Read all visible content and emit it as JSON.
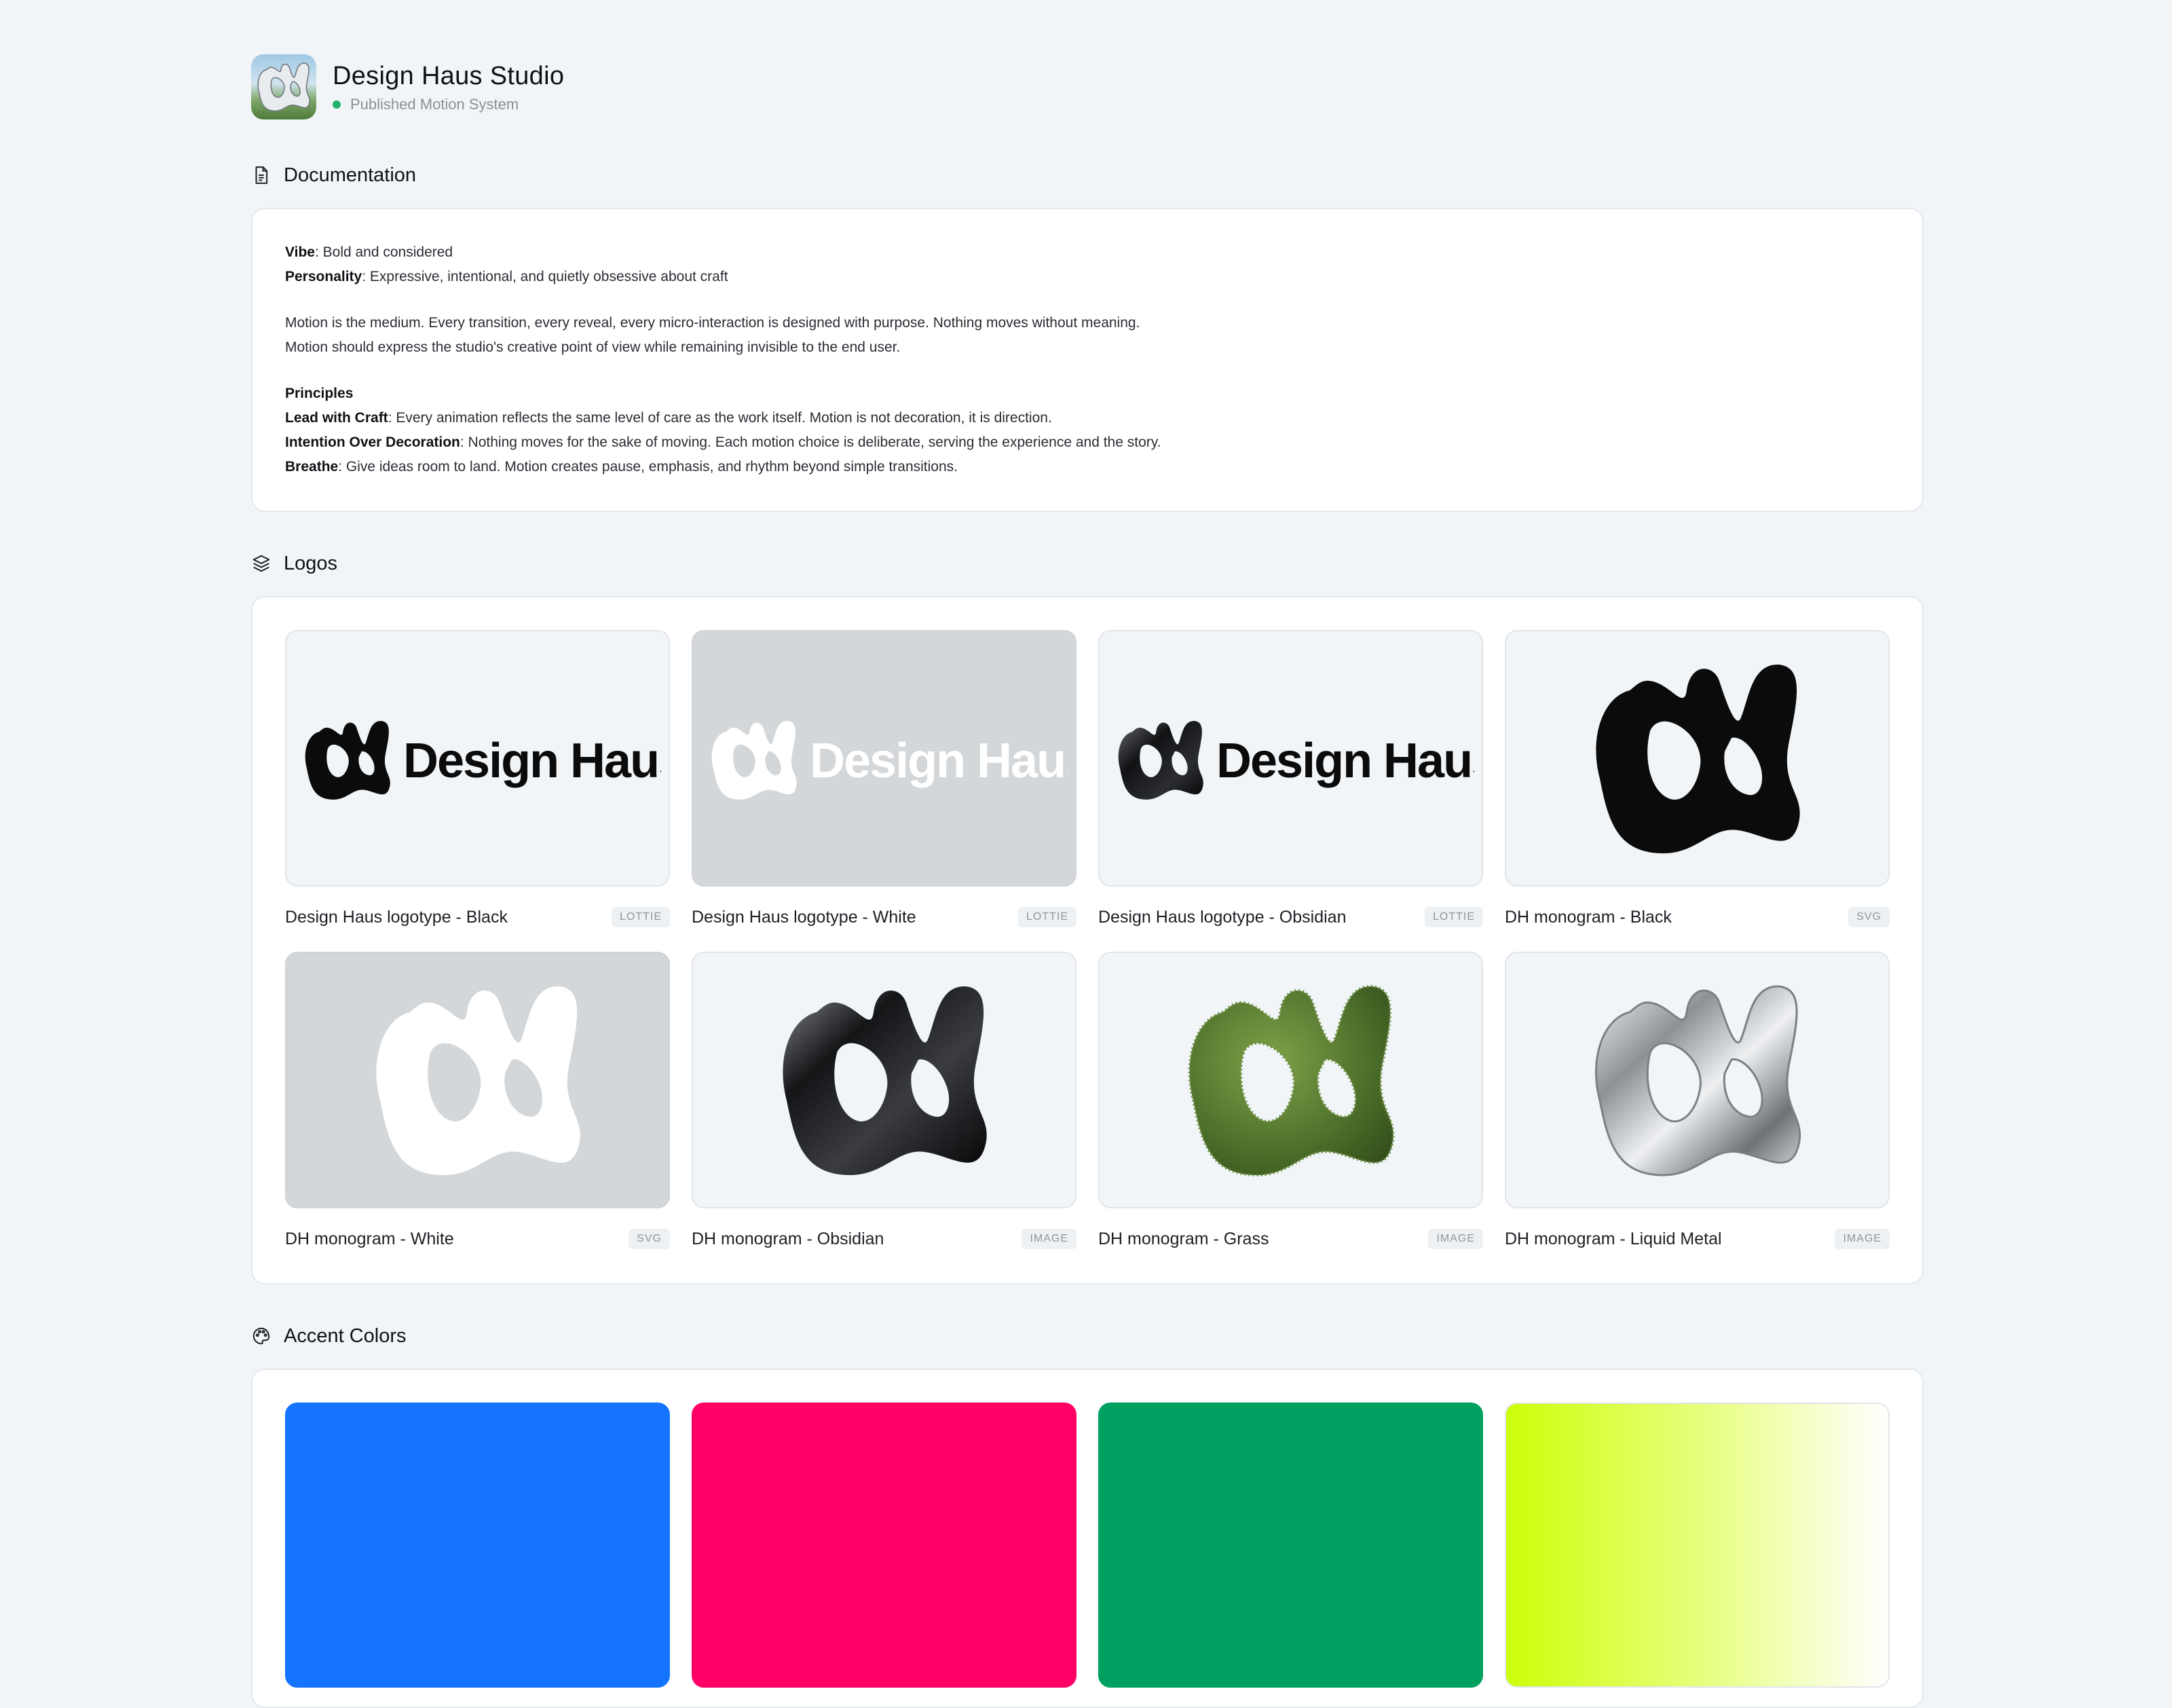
{
  "header": {
    "title": "Design Haus Studio",
    "status": "Published Motion System",
    "status_color": "#22b06a",
    "avatar_icon": "liquid-metal-monogram"
  },
  "documentation": {
    "heading": "Documentation",
    "icon": "document-icon",
    "vibe_label": "Vibe",
    "vibe_text": ": Bold and considered",
    "personality_label": "Personality",
    "personality_text": ": Expressive, intentional, and quietly obsessive about craft",
    "para1": "Motion is the medium. Every transition, every reveal, every micro-interaction is designed with purpose. Nothing moves without meaning.",
    "para2": "Motion should express the studio's creative point of view while remaining invisible to the end user.",
    "principles_heading": "Principles",
    "principles": [
      {
        "label": "Lead with Craft",
        "text": ": Every animation reflects the same level of care as the work itself. Motion is not decoration, it is direction."
      },
      {
        "label": "Intention Over Decoration",
        "text": ": Nothing moves for the sake of moving. Each motion choice is deliberate, serving the experience and the story."
      },
      {
        "label": "Breathe",
        "text": ": Give ideas room to land. Motion creates pause, emphasis, and rhythm beyond simple transitions."
      }
    ]
  },
  "logos": {
    "heading": "Logos",
    "icon": "layers-icon",
    "wordmark": "Design Haus",
    "items": [
      {
        "name": "Design Haus logotype - Black",
        "tag": "LOTTIE",
        "style": "black-logotype"
      },
      {
        "name": "Design Haus logotype - White",
        "tag": "LOTTIE",
        "style": "white-logotype"
      },
      {
        "name": "Design Haus logotype - Obsidian",
        "tag": "LOTTIE",
        "style": "obsidian-logotype"
      },
      {
        "name": "DH monogram - Black",
        "tag": "SVG",
        "style": "black-monogram"
      },
      {
        "name": "DH monogram - White",
        "tag": "SVG",
        "style": "white-monogram"
      },
      {
        "name": "DH monogram - Obsidian",
        "tag": "IMAGE",
        "style": "obsidian-monogram"
      },
      {
        "name": "DH monogram - Grass",
        "tag": "IMAGE",
        "style": "grass-monogram"
      },
      {
        "name": "DH monogram - Liquid Metal",
        "tag": "IMAGE",
        "style": "metal-monogram"
      }
    ]
  },
  "accent_colors": {
    "heading": "Accent Colors",
    "icon": "palette-icon",
    "swatches": [
      "#1473ff",
      "#ff0066",
      "#00a160",
      "#cdff0a"
    ]
  }
}
